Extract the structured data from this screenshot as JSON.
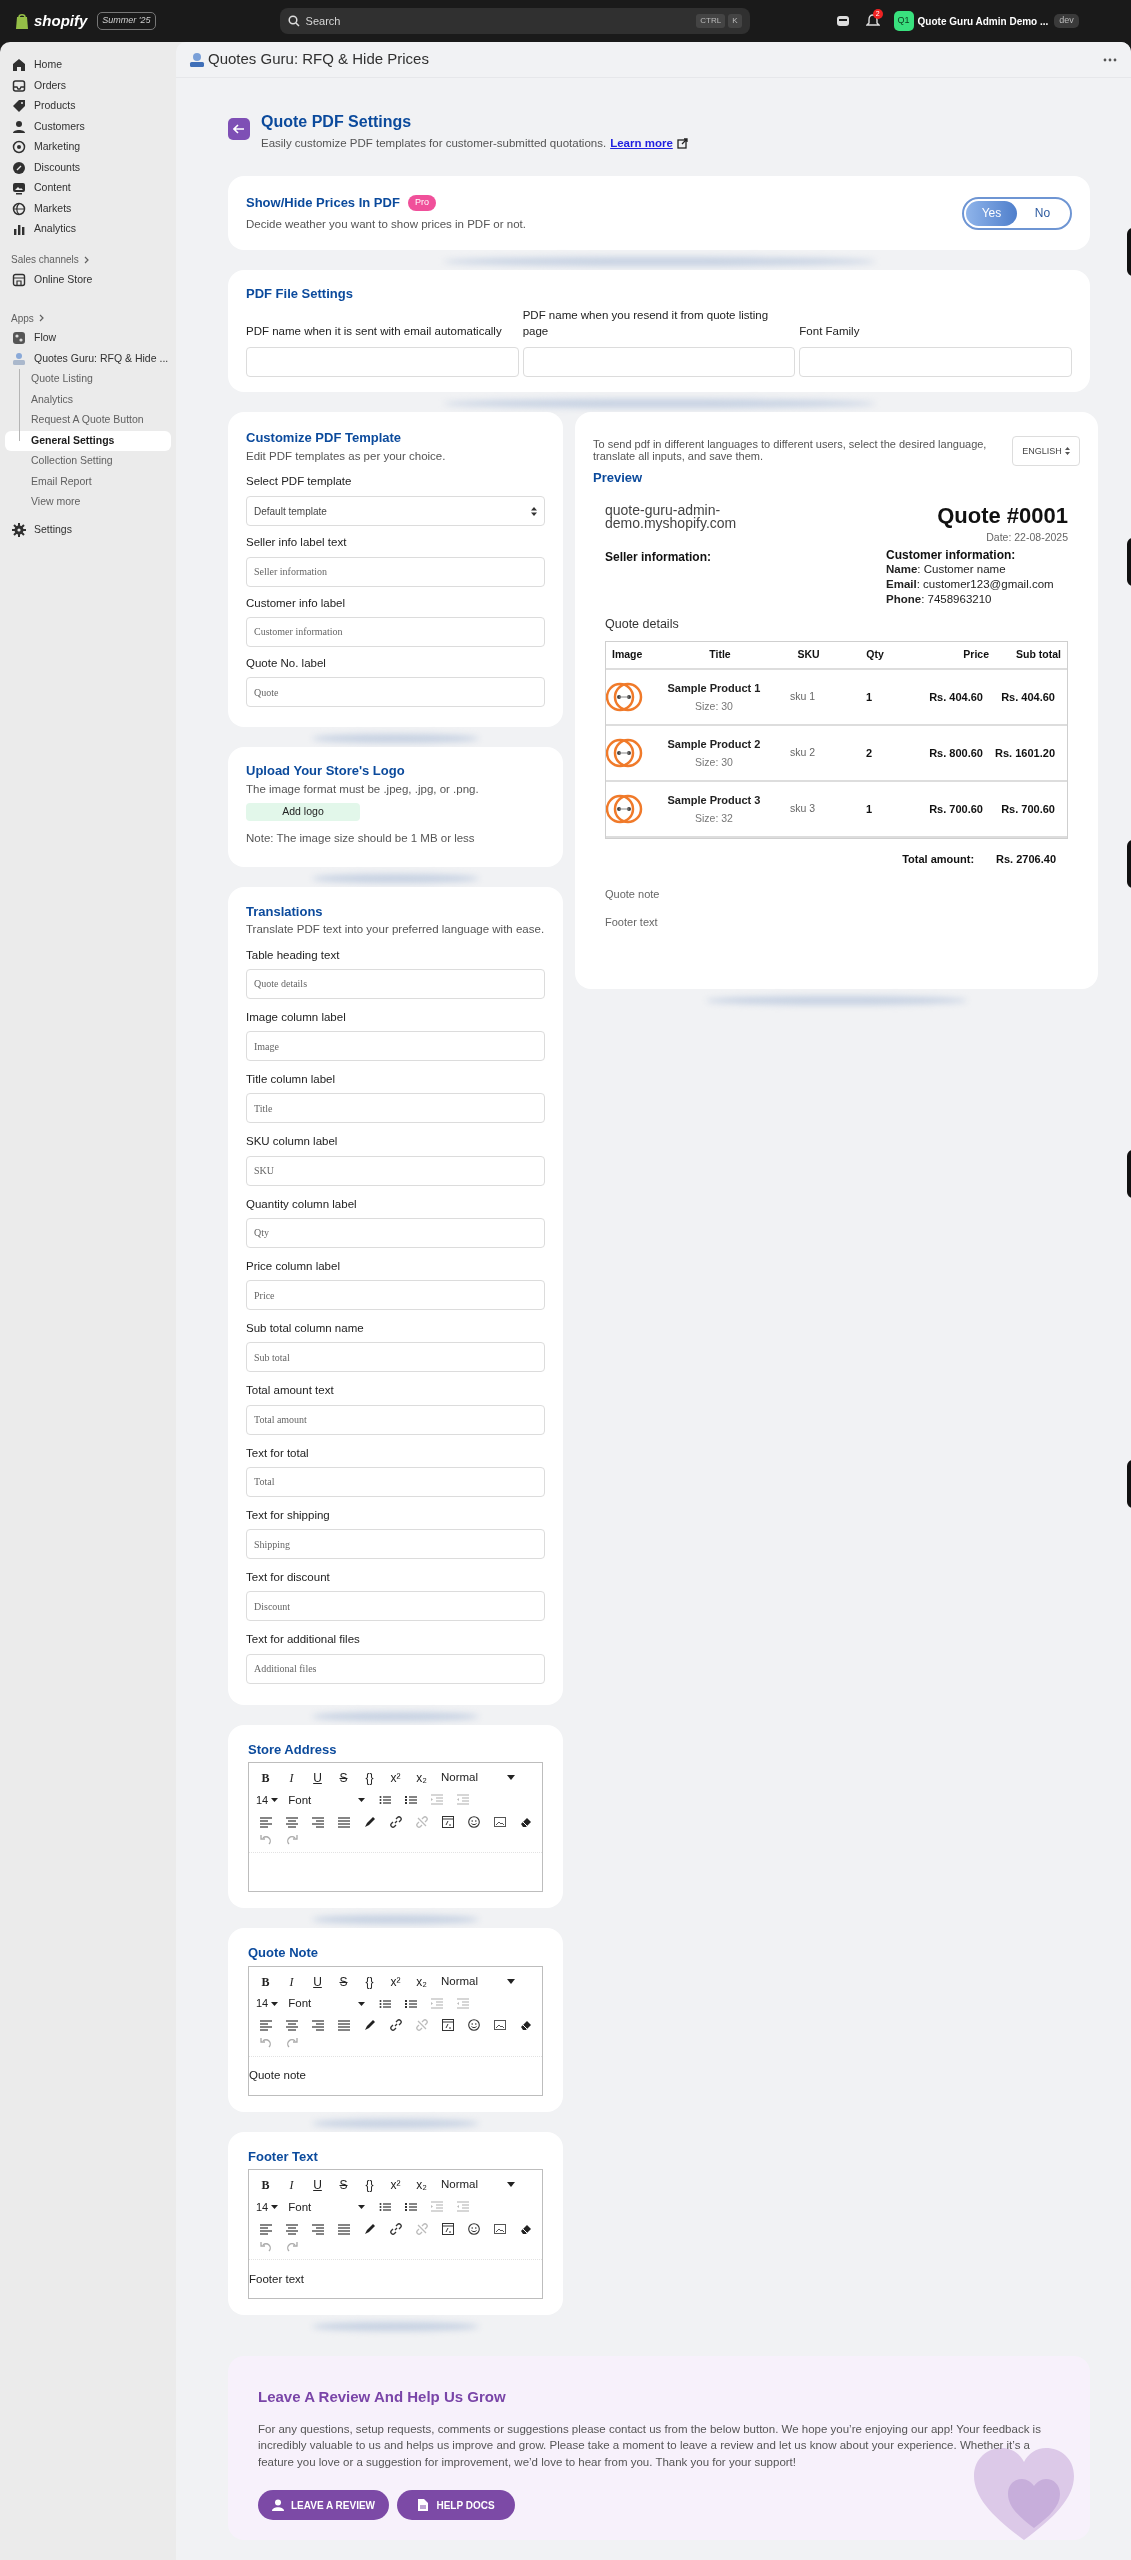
{
  "topbar": {
    "brand": "shopify",
    "edition": "Summer '25",
    "search": {
      "placeholder": "Search",
      "keys": [
        "CTRL",
        "K"
      ]
    },
    "notification_count": "2",
    "store": {
      "initials": "Q1",
      "name": "Quote Guru Admin Demo ...",
      "badge": "dev"
    }
  },
  "sidebar": {
    "items": [
      {
        "label": "Home",
        "selected": false
      },
      {
        "label": "Orders",
        "selected": false
      },
      {
        "label": "Products",
        "selected": false
      },
      {
        "label": "Customers",
        "selected": false
      },
      {
        "label": "Marketing",
        "selected": false
      },
      {
        "label": "Discounts",
        "selected": false
      },
      {
        "label": "Content",
        "selected": false
      },
      {
        "label": "Markets",
        "selected": false
      },
      {
        "label": "Analytics",
        "selected": false
      }
    ],
    "sales_channels": {
      "heading": "Sales channels",
      "items": [
        {
          "label": "Online Store",
          "selected": false
        }
      ]
    },
    "apps": {
      "heading": "Apps",
      "items": [
        {
          "label": "Flow",
          "selected": false
        },
        {
          "label": "Quotes Guru: RFQ & Hide ...",
          "selected": false,
          "children": [
            {
              "label": "Quote Listing",
              "selected": false
            },
            {
              "label": "Analytics",
              "selected": false
            },
            {
              "label": "Request A Quote Button",
              "selected": false
            },
            {
              "label": "General Settings",
              "selected": true
            },
            {
              "label": "Collection Setting",
              "selected": false
            },
            {
              "label": "Email Report",
              "selected": false
            },
            {
              "label": "View more",
              "selected": false
            }
          ]
        }
      ]
    },
    "settings": {
      "label": "Settings",
      "selected": false
    }
  },
  "page": {
    "title": "Quotes Guru: RFQ & Hide Prices"
  },
  "header": {
    "title": "Quote PDF Settings",
    "description": "Easily customize PDF templates for customer-submitted quotations.",
    "link": "Learn more"
  },
  "price_visibility": {
    "title": "Show/Hide Prices In PDF",
    "badge": "Pro",
    "description": "Decide weather you want to show prices in PDF or not.",
    "options": [
      {
        "label": "Yes",
        "selected": true
      },
      {
        "label": "No",
        "selected": false
      }
    ]
  },
  "file_settings": {
    "title": "PDF File Settings",
    "fields": [
      {
        "label": "PDF name when it is sent with email automatically"
      },
      {
        "label": "PDF name when you resend it from quote listing page"
      },
      {
        "label": "Font Family"
      }
    ]
  },
  "template": {
    "title": "Customize PDF Template",
    "description": "Edit PDF templates as per your choice.",
    "select": {
      "label": "Select PDF template",
      "value": "Default template"
    },
    "fields": [
      {
        "label": "Seller info label text",
        "placeholder": "Seller information"
      },
      {
        "label": "Customer info label",
        "placeholder": "Customer information"
      },
      {
        "label": "Quote No. label",
        "placeholder": "Quote"
      }
    ]
  },
  "logo": {
    "title": "Upload Your Store's Logo",
    "description": "The image format must be .jpeg, .jpg, or .png.",
    "button": "Add logo",
    "note": "Note: The image size should be 1 MB or less"
  },
  "translations": {
    "title": "Translations",
    "description": "Translate PDF text into your preferred language with ease.",
    "fields": [
      {
        "label": "Table heading text",
        "placeholder": "Quote details"
      },
      {
        "label": "Image column label",
        "placeholder": "Image"
      },
      {
        "label": "Title column label",
        "placeholder": "Title"
      },
      {
        "label": "SKU column label",
        "placeholder": "SKU"
      },
      {
        "label": "Quantity column label",
        "placeholder": "Qty"
      },
      {
        "label": "Price column label",
        "placeholder": "Price"
      },
      {
        "label": "Sub total column name",
        "placeholder": "Sub total"
      },
      {
        "label": "Total amount text",
        "placeholder": "Total amount"
      },
      {
        "label": "Text for total",
        "placeholder": "Total"
      },
      {
        "label": "Text for shipping",
        "placeholder": "Shipping"
      },
      {
        "label": "Text for discount",
        "placeholder": "Discount"
      },
      {
        "label": "Text for additional files",
        "placeholder": "Additional files"
      }
    ]
  },
  "editors": [
    {
      "title": "Store Address",
      "format_buttons": [
        "B",
        "I",
        "U",
        "S",
        "{}",
        "x²",
        "x₂"
      ],
      "heading": "Normal",
      "size": "14",
      "font": "Font"
    },
    {
      "title": "Quote Note",
      "format_buttons": [
        "B",
        "I",
        "U",
        "S",
        "{}",
        "x²",
        "x₂"
      ],
      "heading": "Normal",
      "size": "14",
      "font": "Font",
      "content": "Quote note"
    },
    {
      "title": "Footer Text",
      "format_buttons": [
        "B",
        "I",
        "U",
        "S",
        "{}",
        "x²",
        "x₂"
      ],
      "heading": "Normal",
      "size": "14",
      "font": "Font",
      "content": "Footer text"
    }
  ],
  "preview": {
    "intro": "To send pdf in different languages to different users, select the desired language, translate all inputs, and save them.",
    "language": "ENGLISH",
    "title": "Preview",
    "store": "quote-guru-admin-demo.myshopify.com",
    "quote_number": "Quote #0001",
    "date": "Date: 22-08-2025",
    "seller_heading": "Seller information:",
    "customer_heading": "Customer information:",
    "customer_lines": [
      "**Name**: Customer name",
      "**Email**: customer123@gmail.com",
      "**Phone**: 7458963210"
    ],
    "table_heading": "Quote details",
    "table": {
      "columns": [
        "Image",
        "Title",
        "SKU",
        "Qty",
        "Price",
        "Sub total"
      ],
      "rows": [
        {
          "kind": "picture",
          "title": "Sample Product 1",
          "size": "Size: 30",
          "sku": "sku 1",
          "qty": "1",
          "price": "Rs. 404.60",
          "subtotal": "Rs. 404.60"
        },
        {
          "kind": "picture",
          "title": "Sample Product 2",
          "size": "Size: 30",
          "sku": "sku 2",
          "qty": "2",
          "price": "Rs. 800.60",
          "subtotal": "Rs. 1601.20"
        },
        {
          "kind": "picture",
          "title": "Sample Product 3",
          "size": "Size: 32",
          "sku": "sku 3",
          "qty": "1",
          "price": "Rs. 700.60",
          "subtotal": "Rs. 700.60"
        }
      ]
    },
    "total_label": "Total amount:",
    "total_value": "Rs. 2706.40",
    "note": "Quote note",
    "footer": "Footer text"
  },
  "review": {
    "title": "Leave A Review And Help Us Grow",
    "text": "For any questions, setup requests, comments or suggestions please contact us from the below button. We hope you’re enjoying our app! Your feedback is incredibly valuable to us and helps us improve and grow. Please take a moment to leave a review and let us know about your experience. Whether it’s a feature you love or a suggestion for improvement, we’d love to hear from you. Thank you for your support!",
    "buttons": [
      {
        "label": "LEAVE A REVIEW"
      },
      {
        "label": "HELP DOCS"
      }
    ]
  }
}
